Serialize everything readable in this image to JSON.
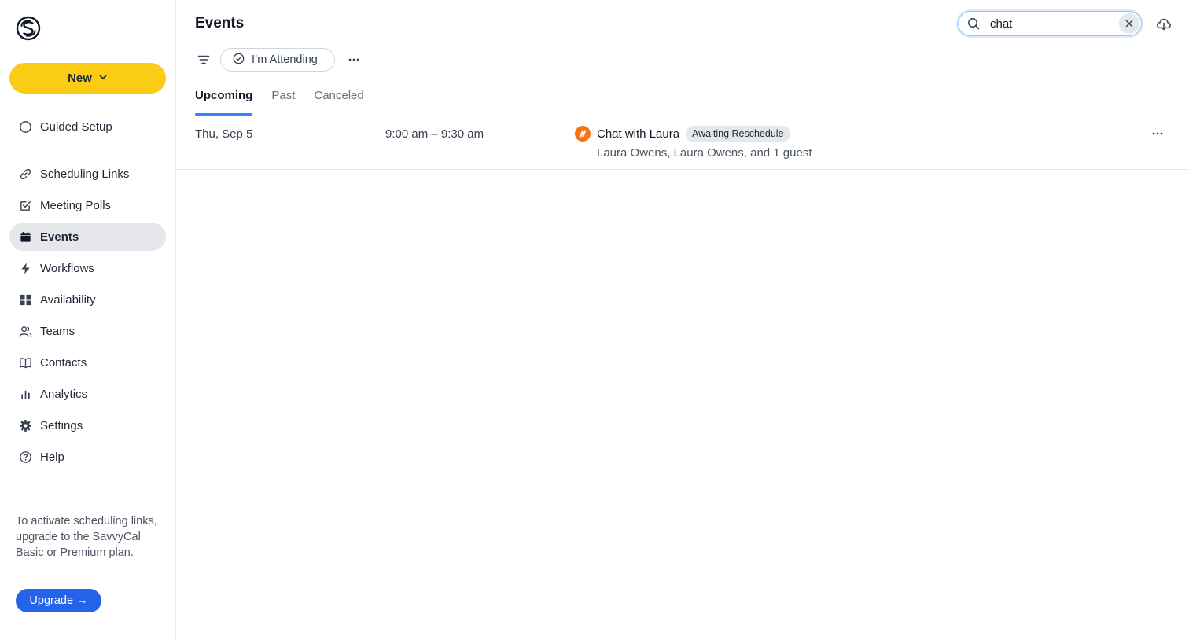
{
  "sidebar": {
    "new_label": "New",
    "items": [
      {
        "key": "guided-setup",
        "label": "Guided Setup",
        "icon": "circle-icon"
      },
      {
        "key": "scheduling-links",
        "label": "Scheduling Links",
        "icon": "link-icon"
      },
      {
        "key": "meeting-polls",
        "label": "Meeting Polls",
        "icon": "checkbox-icon"
      },
      {
        "key": "events",
        "label": "Events",
        "icon": "calendar-icon",
        "active": true
      },
      {
        "key": "workflows",
        "label": "Workflows",
        "icon": "bolt-icon"
      },
      {
        "key": "availability",
        "label": "Availability",
        "icon": "grid-icon"
      },
      {
        "key": "teams",
        "label": "Teams",
        "icon": "users-icon"
      },
      {
        "key": "contacts",
        "label": "Contacts",
        "icon": "book-icon"
      },
      {
        "key": "analytics",
        "label": "Analytics",
        "icon": "bar-chart-icon"
      },
      {
        "key": "settings",
        "label": "Settings",
        "icon": "gear-icon"
      },
      {
        "key": "help",
        "label": "Help",
        "icon": "question-icon"
      }
    ],
    "upgrade_text": "To activate scheduling links, upgrade to the SavvyCal Basic or Premium plan.",
    "upgrade_label": "Upgrade →"
  },
  "header": {
    "title": "Events",
    "search_value": "chat",
    "attending_label": "I’m Attending"
  },
  "tabs": [
    {
      "label": "Upcoming",
      "active": true
    },
    {
      "label": "Past"
    },
    {
      "label": "Canceled"
    }
  ],
  "events": [
    {
      "date": "Thu, Sep 5",
      "time": "9:00 am – 9:30 am",
      "title": "Chat with Laura",
      "badge": "Awaiting Reschedule",
      "guests": "Laura Owens, Laura Owens, and 1 guest"
    }
  ],
  "colors": {
    "accent_yellow": "#facc15",
    "accent_blue": "#2563eb",
    "tab_underline": "#3b82f6",
    "event_icon": "#f97316"
  }
}
